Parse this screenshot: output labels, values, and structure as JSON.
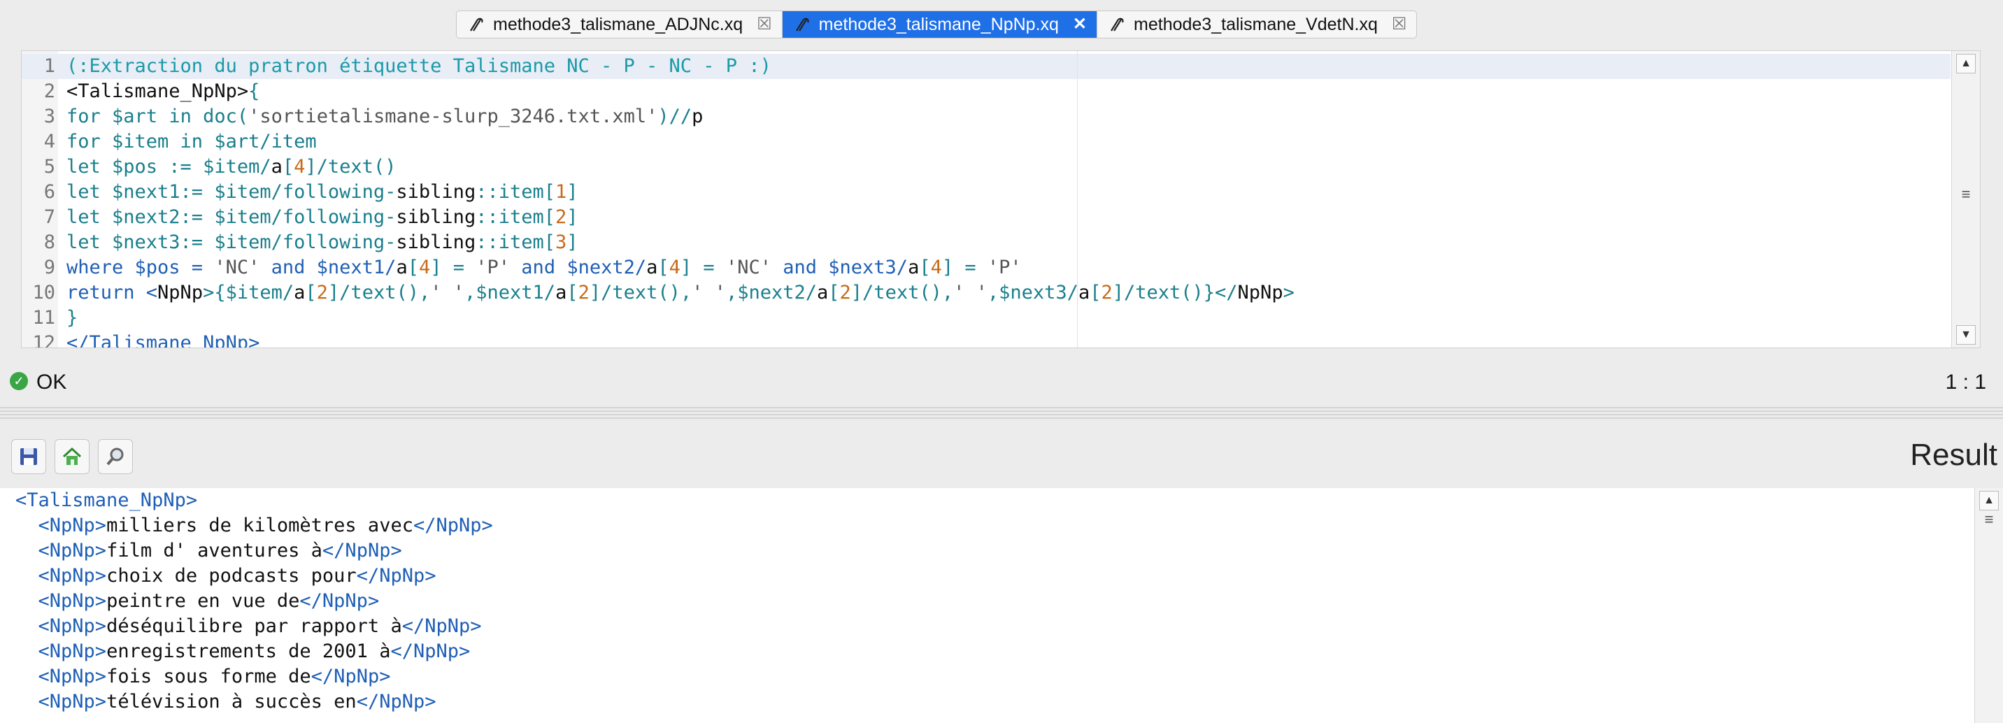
{
  "tabs": [
    {
      "label": "methode3_talismane_ADJNc.xq",
      "active": false
    },
    {
      "label": "methode3_talismane_NpNp.xq",
      "active": true
    },
    {
      "label": "methode3_talismane_VdetN.xq",
      "active": false
    }
  ],
  "editor": {
    "line_numbers": [
      "1",
      "2",
      "3",
      "4",
      "5",
      "6",
      "7",
      "8",
      "9",
      "10",
      "11",
      "12"
    ],
    "comment": "(:Extraction du pratron étiquette Talismane NC - P - NC - P :)",
    "lines": {
      "l2_open": "<Talismane_NpNp>",
      "l2_brace": "{",
      "l3_for": "for",
      "l3_var": "$art",
      "l3_in": "in",
      "l3_fn": "doc(",
      "l3_str": "'sortietalismane-slurp_3246.txt.xml'",
      "l3_close": ")//",
      "l3_p": "p",
      "l4": "for $item in $art/item",
      "l5_a": "let $pos := $item/",
      "l5_b": "a",
      "l5_c": "[",
      "l5_n": "4",
      "l5_d": "]/text()",
      "l6_a": "let $next1:= $item/following-",
      "l6_b": "sibling",
      "l6_c": "::item[",
      "l6_n": "1",
      "l6_d": "]",
      "l7_a": "let $next2:= $item/following-",
      "l7_b": "sibling",
      "l7_c": "::item[",
      "l7_n": "2",
      "l7_d": "]",
      "l8_a": "let $next3:= $item/following-",
      "l8_b": "sibling",
      "l8_c": "::item[",
      "l8_n": "3",
      "l8_d": "]",
      "l9_where": "where $pos = ",
      "l9_s1": "'NC'",
      "l9_and1": " and $next1/",
      "l9_a1": "a",
      "l9_b1": "[",
      "l9_n1": "4",
      "l9_c1": "] = ",
      "l9_s2": "'P'",
      "l9_and2": " and $next2/",
      "l9_a2": "a",
      "l9_b2": "[",
      "l9_n2": "4",
      "l9_c2": "] = ",
      "l9_s3": "'NC'",
      "l9_and3": " and $next3/",
      "l9_a3": "a",
      "l9_b3": "[",
      "l9_n3": "4",
      "l9_c3": "] = ",
      "l9_s4": "'P'",
      "l10_ret": "return <",
      "l10_tag": "NpNp",
      "l10_x1": ">{$item/",
      "l10_a1": "a",
      "l10_b1": "[",
      "l10_n1": "2",
      "l10_c1": "]/text(),",
      "l10_s1": "' '",
      "l10_x2": ",$next1/",
      "l10_a2": "a",
      "l10_b2": "[",
      "l10_n2": "2",
      "l10_c2": "]/text(),",
      "l10_s2": "' '",
      "l10_x3": ",$next2/",
      "l10_a3": "a",
      "l10_b3": "[",
      "l10_n3": "2",
      "l10_c3": "]/text(),",
      "l10_s3": "' '",
      "l10_x4": ",$next3/",
      "l10_a4": "a",
      "l10_b4": "[",
      "l10_n4": "2",
      "l10_c4": "]/text()}</",
      "l10_tag2": "NpNp",
      "l10_end": ">",
      "l11": "}",
      "l12": "</Talismane_NpNp>"
    }
  },
  "status": {
    "text": "OK",
    "position": "1 : 1"
  },
  "result": {
    "title": "Result",
    "root_open": "<Talismane_NpNp>",
    "tag_open": "<NpNp>",
    "tag_close": "</NpNp>",
    "items": [
      "milliers de kilomètres avec",
      "film d' aventures à",
      "choix de podcasts pour",
      "peintre en vue de",
      "déséquilibre par rapport à",
      "enregistrements de 2001 à",
      "fois sous forme de",
      "télévision à succès en"
    ]
  },
  "icons": [
    "xquery-file-icon",
    "close-icon",
    "ok-check-icon",
    "save-icon",
    "home-icon",
    "search-icon"
  ]
}
